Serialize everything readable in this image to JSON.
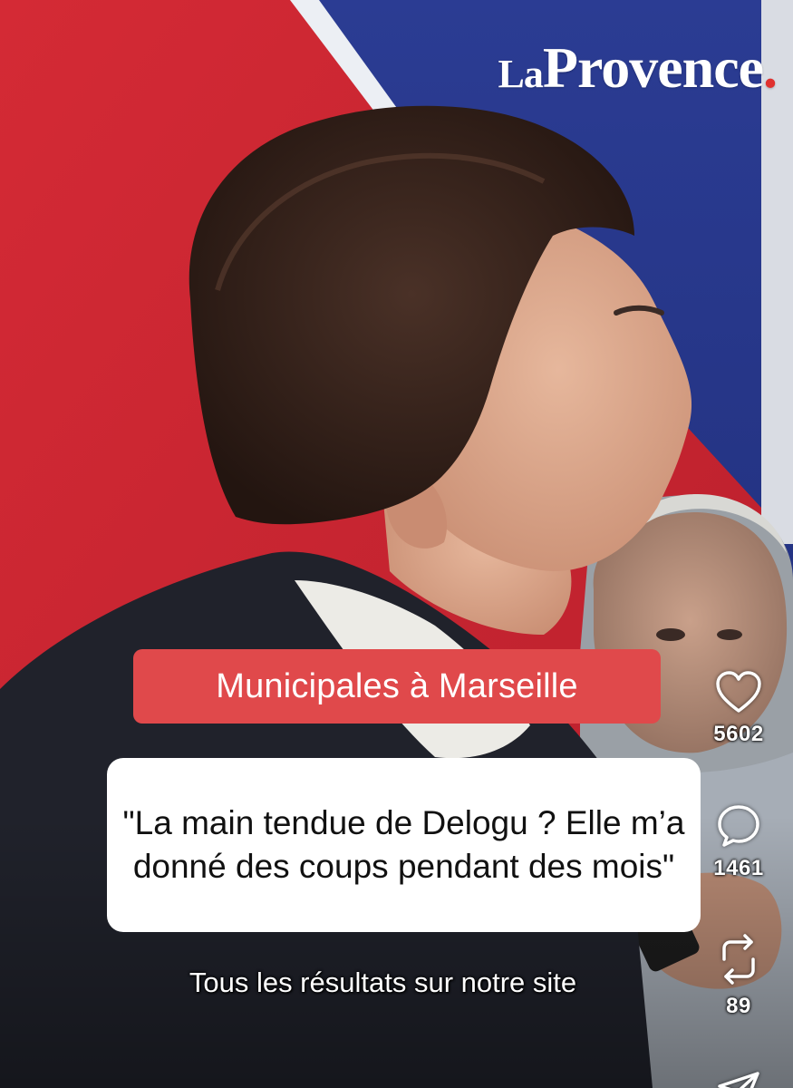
{
  "brand": {
    "logo_prefix": "La",
    "logo_main": "Provence",
    "logo_dot": ".",
    "accent_color": "#e0312f"
  },
  "overlay": {
    "tag_text": "Municipales à Marseille",
    "tag_color": "#e0494b",
    "quote_text": "\"La main tendue de Delogu ? Elle m’a donné des coups pendant des mois\"",
    "subtitle_text": "Tous les résultats sur notre site"
  },
  "actions": {
    "like": {
      "icon": "heart-icon",
      "count": "5602"
    },
    "comment": {
      "icon": "comment-bubble-icon",
      "count": "1461"
    },
    "repost": {
      "icon": "repost-icon",
      "count": "89"
    },
    "share": {
      "icon": "share-icon"
    }
  }
}
